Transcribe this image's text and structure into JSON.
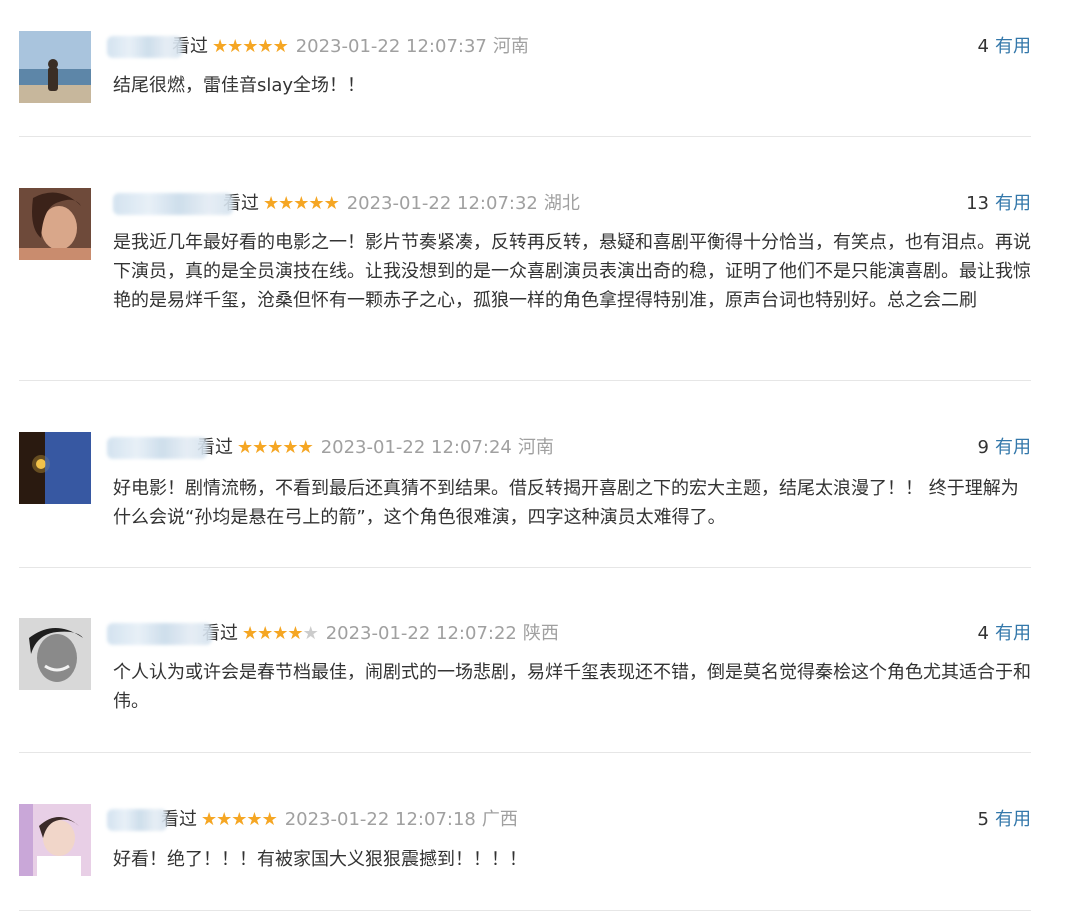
{
  "comments": [
    {
      "user_suffix": "看过",
      "rating": 5,
      "time": "2023-01-22 12:07:37",
      "location": "河南",
      "useful_count": "4",
      "useful_label": "有用",
      "text": "结尾很燃，雷佳音slay全场！！",
      "avatar_icon": "beach-person-avatar"
    },
    {
      "user_suffix": "看过",
      "rating": 5,
      "time": "2023-01-22 12:07:32",
      "location": "湖北",
      "useful_count": "13",
      "useful_label": "有用",
      "text": "是我近几年最好看的电影之一！影片节奏紧凑，反转再反转，悬疑和喜剧平衡得十分恰当，有笑点，也有泪点。再说下演员，真的是全员演技在线。让我没想到的是一众喜剧演员表演出奇的稳，证明了他们不是只能演喜剧。最让我惊艳的是易烊千玺，沧桑但怀有一颗赤子之心，孤狼一样的角色拿捏得特别准，原声台词也特别好。总之会二刷",
      "avatar_icon": "woman-portrait-avatar"
    },
    {
      "user_suffix": "看过",
      "rating": 5,
      "time": "2023-01-22 12:07:24",
      "location": "河南",
      "useful_count": "9",
      "useful_label": "有用",
      "text": "好电影！剧情流畅，不看到最后还真猜不到结果。借反转揭开喜剧之下的宏大主题，结尾太浪漫了！！ 终于理解为什么会说“孙均是悬在弓上的箭”，这个角色很难演，四字这种演员太难得了。",
      "avatar_icon": "night-sky-avatar"
    },
    {
      "user_suffix": "看过",
      "rating": 4,
      "time": "2023-01-22 12:07:22",
      "location": "陕西",
      "useful_count": "4",
      "useful_label": "有用",
      "text": "个人认为或许会是春节档最佳，闹剧式的一场悲剧，易烊千玺表现还不错，倒是莫名觉得秦桧这个角色尤其适合于和伟。",
      "avatar_icon": "smiling-man-avatar"
    },
    {
      "user_suffix": "看过",
      "rating": 5,
      "time": "2023-01-22 12:07:18",
      "location": "广西",
      "useful_count": "5",
      "useful_label": "有用",
      "text": "好看！绝了！！！有被家国大义狠狠震撼到！！！！",
      "avatar_icon": "girl-pink-avatar"
    }
  ],
  "colors": {
    "star_on": "#f5a623",
    "star_off": "#cccccc",
    "useful_link": "#3377aa",
    "meta_gray": "#a0a0a0",
    "text": "#333333",
    "divider": "#e6e6e6"
  }
}
